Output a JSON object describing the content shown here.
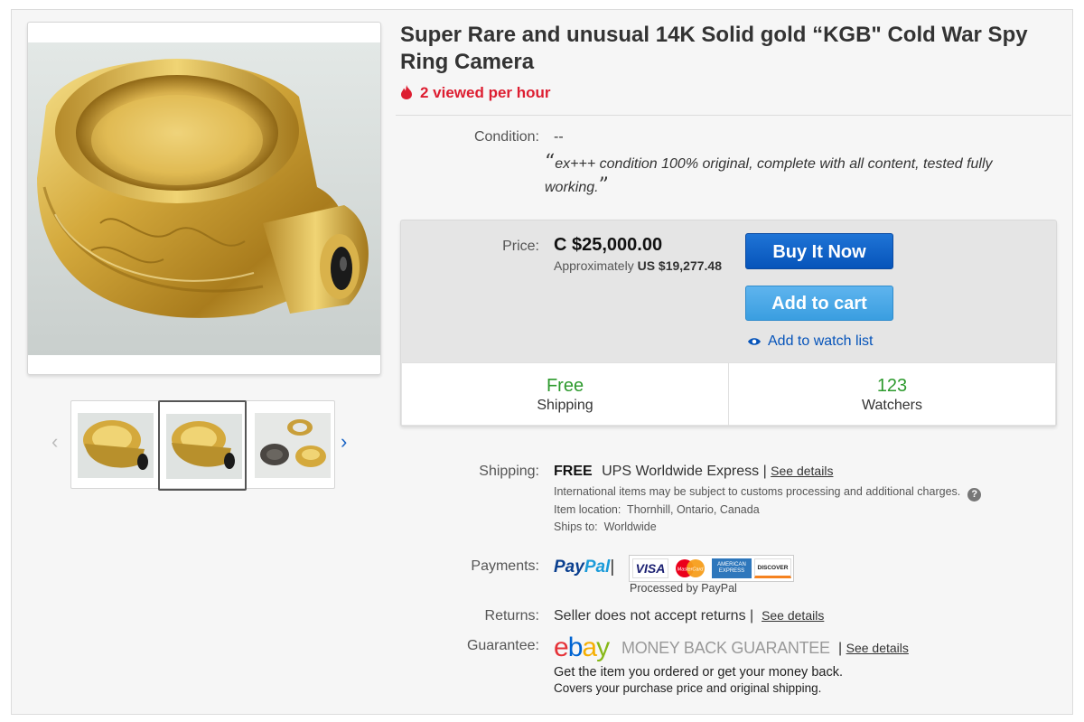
{
  "listing": {
    "title": "Super Rare and unusual 14K Solid gold “KGB\" Cold War Spy Ring Camera",
    "viewed_text": "2 viewed per hour"
  },
  "condition": {
    "label": "Condition:",
    "value": "--",
    "description": "ex+++ condition 100% original, complete with all content, tested fully working.",
    "open_quote": "“",
    "close_quote": "”"
  },
  "price": {
    "label": "Price:",
    "value": "C $25,000.00",
    "approx_prefix": "Approximately",
    "approx_value": "US $19,277.48"
  },
  "actions": {
    "buy_now": "Buy It Now",
    "add_to_cart": "Add to cart",
    "watch_list": "Add to watch list"
  },
  "stats": {
    "shipping_big": "Free",
    "shipping_small": "Shipping",
    "watchers_big": "123",
    "watchers_small": "Watchers"
  },
  "shipping": {
    "label": "Shipping:",
    "free": "FREE",
    "service": "UPS Worldwide Express",
    "separator": "|",
    "see_details": "See details",
    "intl_note": "International items may be subject to customs processing and additional charges.",
    "help": "?",
    "item_location": "Item location:  Thornhill, Ontario, Canada",
    "ships_to": "Ships to:  Worldwide"
  },
  "payments": {
    "label": "Payments:",
    "paypal_1": "Pay",
    "paypal_2": "Pal",
    "separator": "|",
    "processed": "Processed by PayPal",
    "visa": "VISA",
    "mastercard": "MasterCard",
    "amex": "AMERICAN EXPRESS",
    "discover": "DISCOVER"
  },
  "returns": {
    "label": "Returns:",
    "text": "Seller does not accept returns",
    "separator": "|",
    "see_details": "See details"
  },
  "guarantee": {
    "label": "Guarantee:",
    "logo": {
      "e": "e",
      "b": "b",
      "a": "a",
      "y": "y"
    },
    "mbg": "MONEY BACK GUARANTEE",
    "separator": "|",
    "see_details": "See details",
    "line1": "Get the item you ordered or get your money back.",
    "line2": "Covers your purchase price and original shipping."
  },
  "colors": {
    "link_blue": "#0654ba",
    "viewed_red": "#dd1e31",
    "free_green": "#2d9a2d"
  }
}
